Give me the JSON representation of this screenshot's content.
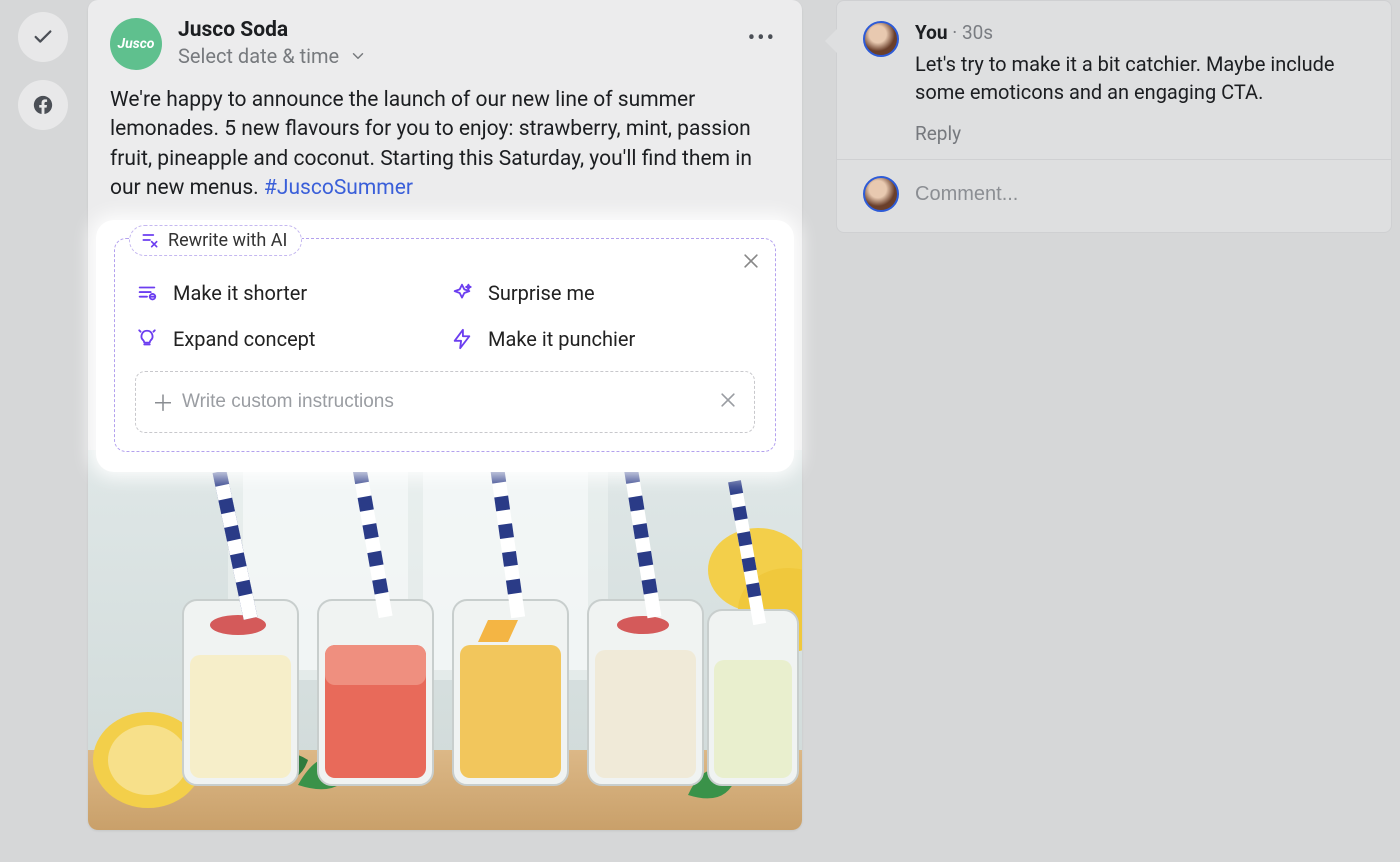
{
  "post": {
    "brand_name": "Jusco Soda",
    "brand_logo_text": "Jusco",
    "schedule_label": "Select date & time",
    "body_text": "We're happy to announce the launch of our new line of summer lemonades. 5 new flavours for you to enjoy: strawberry, mint, passion fruit, pineapple and coconut. Starting this Saturday, you'll find them in our new menus. ",
    "hashtag": "#JuscoSummer"
  },
  "ai_panel": {
    "title": "Rewrite with AI",
    "options": [
      {
        "id": "shorter",
        "label": "Make it shorter"
      },
      {
        "id": "surprise",
        "label": "Surprise me"
      },
      {
        "id": "expand",
        "label": "Expand concept"
      },
      {
        "id": "punchier",
        "label": "Make it punchier"
      }
    ],
    "custom_placeholder": "Write custom instructions"
  },
  "comments": {
    "thread": {
      "author": "You",
      "time": "30s",
      "text": "Let's try to make it a bit catchier. Maybe include some emoticons and an engaging CTA.",
      "reply_label": "Reply"
    },
    "input_placeholder": "Comment..."
  }
}
